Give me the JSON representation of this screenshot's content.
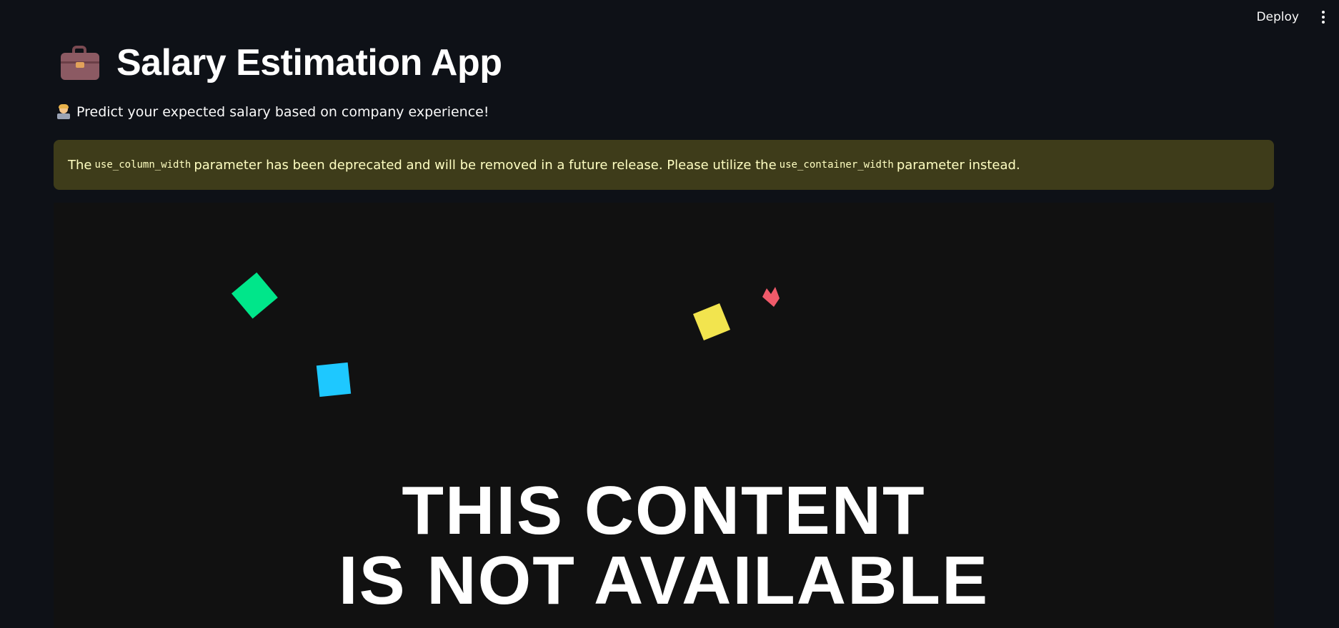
{
  "header": {
    "deploy_label": "Deploy",
    "menu_icon": "vertical-ellipsis-icon"
  },
  "page": {
    "title_icon": "briefcase-icon",
    "title": "Salary Estimation App",
    "subtitle_icon": "technologist-icon",
    "subtitle": "Predict your expected salary based on company experience!"
  },
  "warning": {
    "text_1": "The",
    "code_1": "use_column_width",
    "text_2": "parameter has been deprecated and will be removed in a future release. Please utilize the",
    "code_2": "use_container_width",
    "text_3": "parameter instead."
  },
  "media": {
    "line_1": "THIS CONTENT",
    "line_2": "IS NOT AVAILABLE"
  },
  "colors": {
    "background": "#0e1117",
    "warning_bg": "#3e3c1a",
    "warning_text": "#ffffc2",
    "media_bg": "#111111",
    "confetti_green": "#00e68a",
    "confetti_blue": "#1ec8ff",
    "confetti_yellow": "#f2e44e",
    "confetti_red": "#f05a6a"
  }
}
